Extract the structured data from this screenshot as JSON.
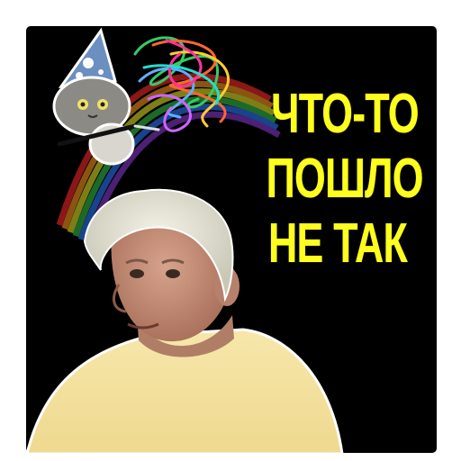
{
  "caption": {
    "lines": [
      "ЧТО-ТО",
      "ПОШЛО",
      "НЕ  ТАК"
    ]
  },
  "colors": {
    "background": "#000000",
    "caption_text": "#ffff1f",
    "shirt": "#f4e3a4",
    "hair": "#e8e6d8",
    "skin": "#c8927a"
  },
  "icons": {
    "sticker_subject": "man-portrait",
    "wizard_cat": "cat-in-wizard-hat-icon",
    "scribble": "rainbow-scribble-icon"
  }
}
